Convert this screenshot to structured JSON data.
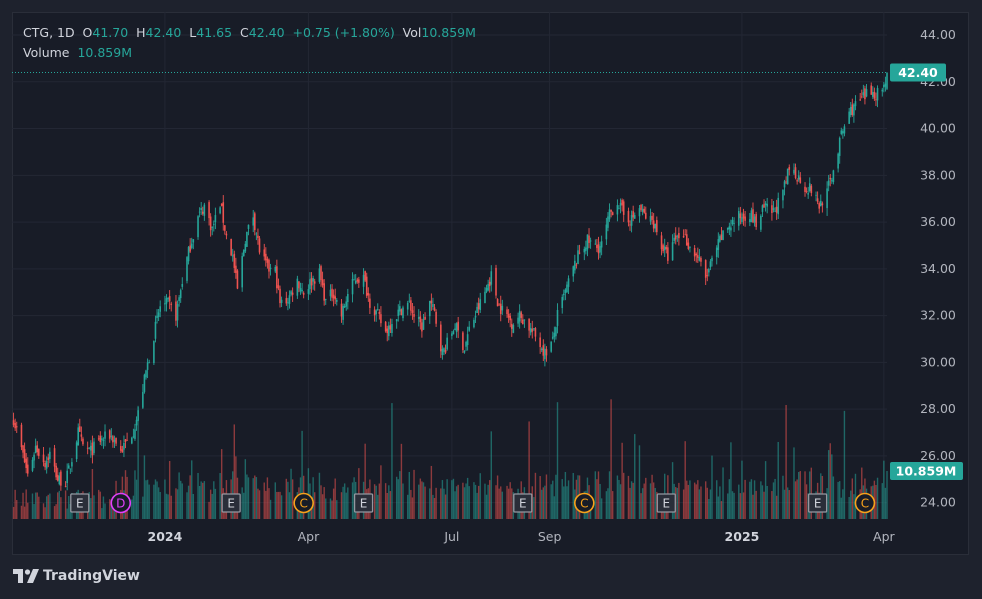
{
  "legend": {
    "symbol": "CTG",
    "interval": "1D",
    "o_label": "O",
    "o_value": "41.70",
    "h_label": "H",
    "h_value": "42.40",
    "l_label": "L",
    "l_value": "41.65",
    "c_label": "C",
    "c_value": "42.40",
    "change": "+0.75 (+1.80%)",
    "vol_label": "Vol",
    "vol_value": "10.859M",
    "volume_label": "Volume",
    "volume_value": "10.859M"
  },
  "brand": {
    "name": "TradingView"
  },
  "colors": {
    "up": "#26a69a",
    "down": "#ef5350",
    "bg": "#181c27",
    "grid": "#232734",
    "axis_text": "#b2b5be",
    "earnings": "#9598a1",
    "dividend": "#e040fb",
    "call": "#f7a21b"
  },
  "chart_data": {
    "type": "candlestick",
    "y_ticks": [
      "44.00",
      "42.00",
      "40.00",
      "38.00",
      "36.00",
      "34.00",
      "32.00",
      "30.00",
      "28.00",
      "26.00",
      "24.00"
    ],
    "ylim": [
      23.3,
      44.9
    ],
    "x_ticks": [
      {
        "label": "2024",
        "date": "2024-01-01",
        "bold": true
      },
      {
        "label": "Apr",
        "date": "2024-04-01",
        "bold": false
      },
      {
        "label": "Jul",
        "date": "2024-07-01",
        "bold": false
      },
      {
        "label": "Sep",
        "date": "2024-09-01",
        "bold": false
      },
      {
        "label": "2025",
        "date": "2025-01-01",
        "bold": true
      },
      {
        "label": "Apr",
        "date": "2025-04-01",
        "bold": false
      }
    ],
    "xlim": [
      "2023-09-26",
      "2025-04-03"
    ],
    "last_price": "42.40",
    "last_volume": "10.859M",
    "price_keypoints": [
      [
        "2023-09-27",
        27.6
      ],
      [
        "2023-10-02",
        26.3
      ],
      [
        "2023-10-06",
        25.2
      ],
      [
        "2023-10-11",
        26.4
      ],
      [
        "2023-10-17",
        25.7
      ],
      [
        "2023-10-20",
        26.1
      ],
      [
        "2023-10-25",
        25.0
      ],
      [
        "2023-10-30",
        24.9
      ],
      [
        "2023-11-02",
        25.6
      ],
      [
        "2023-11-07",
        27.0
      ],
      [
        "2023-11-10",
        26.4
      ],
      [
        "2023-11-15",
        26.2
      ],
      [
        "2023-11-20",
        26.6
      ],
      [
        "2023-11-27",
        26.9
      ],
      [
        "2023-12-01",
        26.6
      ],
      [
        "2023-12-04",
        26.2
      ],
      [
        "2023-12-07",
        26.5
      ],
      [
        "2023-12-12",
        27.1
      ],
      [
        "2023-12-15",
        27.8
      ],
      [
        "2023-12-20",
        29.6
      ],
      [
        "2023-12-26",
        31.5
      ],
      [
        "2023-12-29",
        32.4
      ],
      [
        "2024-01-03",
        32.5
      ],
      [
        "2024-01-08",
        32.0
      ],
      [
        "2024-01-12",
        33.5
      ],
      [
        "2024-01-17",
        35.0
      ],
      [
        "2024-01-22",
        36.2
      ],
      [
        "2024-01-26",
        36.7
      ],
      [
        "2024-01-31",
        35.7
      ],
      [
        "2024-02-05",
        36.8
      ],
      [
        "2024-02-09",
        35.4
      ],
      [
        "2024-02-13",
        34.5
      ],
      [
        "2024-02-16",
        33.1
      ],
      [
        "2024-02-21",
        35.3
      ],
      [
        "2024-02-26",
        36.3
      ],
      [
        "2024-03-01",
        34.8
      ],
      [
        "2024-03-06",
        34.0
      ],
      [
        "2024-03-11",
        33.9
      ],
      [
        "2024-03-14",
        32.5
      ],
      [
        "2024-03-19",
        32.7
      ],
      [
        "2024-03-25",
        33.5
      ],
      [
        "2024-03-29",
        33.0
      ],
      [
        "2024-04-03",
        33.5
      ],
      [
        "2024-04-08",
        33.8
      ],
      [
        "2024-04-12",
        32.6
      ],
      [
        "2024-04-17",
        33.0
      ],
      [
        "2024-04-22",
        32.0
      ],
      [
        "2024-04-26",
        32.9
      ],
      [
        "2024-05-01",
        33.6
      ],
      [
        "2024-05-06",
        33.6
      ],
      [
        "2024-05-10",
        32.6
      ],
      [
        "2024-05-15",
        32.0
      ],
      [
        "2024-05-20",
        31.3
      ],
      [
        "2024-05-24",
        31.8
      ],
      [
        "2024-05-30",
        32.3
      ],
      [
        "2024-06-04",
        32.5
      ],
      [
        "2024-06-07",
        32.0
      ],
      [
        "2024-06-12",
        31.5
      ],
      [
        "2024-06-17",
        32.6
      ],
      [
        "2024-06-20",
        32.1
      ],
      [
        "2024-06-25",
        30.4
      ],
      [
        "2024-06-28",
        30.8
      ],
      [
        "2024-07-03",
        31.6
      ],
      [
        "2024-07-09",
        30.6
      ],
      [
        "2024-07-12",
        31.4
      ],
      [
        "2024-07-17",
        32.2
      ],
      [
        "2024-07-22",
        33.0
      ],
      [
        "2024-07-26",
        33.7
      ],
      [
        "2024-07-31",
        32.4
      ],
      [
        "2024-08-05",
        32.0
      ],
      [
        "2024-08-08",
        31.7
      ],
      [
        "2024-08-13",
        32.0
      ],
      [
        "2024-08-16",
        31.8
      ],
      [
        "2024-08-21",
        31.3
      ],
      [
        "2024-08-26",
        30.8
      ],
      [
        "2024-08-29",
        30.4
      ],
      [
        "2024-09-03",
        30.9
      ],
      [
        "2024-09-06",
        32.0
      ],
      [
        "2024-09-11",
        33.0
      ],
      [
        "2024-09-16",
        34.0
      ],
      [
        "2024-09-20",
        34.7
      ],
      [
        "2024-09-25",
        35.2
      ],
      [
        "2024-10-01",
        34.9
      ],
      [
        "2024-10-04",
        35.0
      ],
      [
        "2024-10-09",
        36.3
      ],
      [
        "2024-10-14",
        36.9
      ],
      [
        "2024-10-18",
        36.3
      ],
      [
        "2024-10-23",
        36.1
      ],
      [
        "2024-10-28",
        36.6
      ],
      [
        "2024-11-01",
        36.2
      ],
      [
        "2024-11-06",
        36.0
      ],
      [
        "2024-11-11",
        35.0
      ],
      [
        "2024-11-15",
        34.5
      ],
      [
        "2024-11-20",
        35.3
      ],
      [
        "2024-11-25",
        35.5
      ],
      [
        "2024-11-29",
        34.9
      ],
      [
        "2024-12-04",
        34.5
      ],
      [
        "2024-12-09",
        33.6
      ],
      [
        "2024-12-13",
        34.3
      ],
      [
        "2024-12-18",
        35.2
      ],
      [
        "2024-12-23",
        35.8
      ],
      [
        "2024-12-30",
        36.2
      ],
      [
        "2025-01-06",
        36.4
      ],
      [
        "2025-01-10",
        35.9
      ],
      [
        "2025-01-15",
        36.6
      ],
      [
        "2025-01-21",
        36.4
      ],
      [
        "2025-01-27",
        37.2
      ],
      [
        "2025-01-31",
        38.3
      ],
      [
        "2025-02-05",
        38.0
      ],
      [
        "2025-02-10",
        37.5
      ],
      [
        "2025-02-14",
        37.4
      ],
      [
        "2025-02-19",
        36.7
      ],
      [
        "2025-02-24",
        37.3
      ],
      [
        "2025-02-28",
        38.2
      ],
      [
        "2025-03-05",
        39.7
      ],
      [
        "2025-03-10",
        40.7
      ],
      [
        "2025-03-14",
        41.0
      ],
      [
        "2025-03-19",
        41.3
      ],
      [
        "2025-03-24",
        41.6
      ],
      [
        "2025-03-27",
        41.5
      ],
      [
        "2025-04-01",
        41.8
      ],
      [
        "2025-04-03",
        42.4
      ]
    ]
  }
}
